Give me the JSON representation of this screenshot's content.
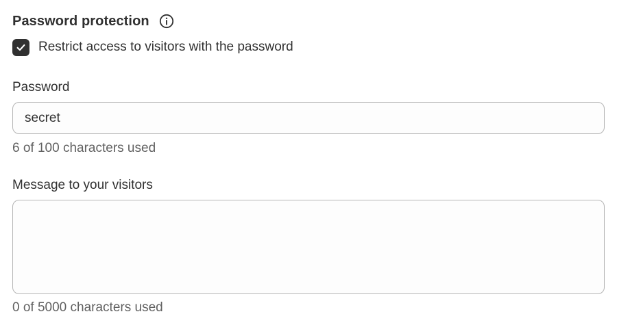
{
  "password_protection": {
    "title": "Password protection",
    "info_icon": "info-circle-icon",
    "restrict_checkbox": {
      "label": "Restrict access to visitors with the password",
      "checked": true,
      "icon": "checkmark-icon"
    }
  },
  "password_field": {
    "label": "Password",
    "value": "secret",
    "help": "6 of 100 characters used"
  },
  "message_field": {
    "label": "Message to your visitors",
    "value": "",
    "help": "0 of 5000 characters used"
  },
  "colors": {
    "text": "#303030",
    "subdued_text": "#616161",
    "checkbox_fill": "#303030",
    "input_border": "#b5b5b5"
  }
}
